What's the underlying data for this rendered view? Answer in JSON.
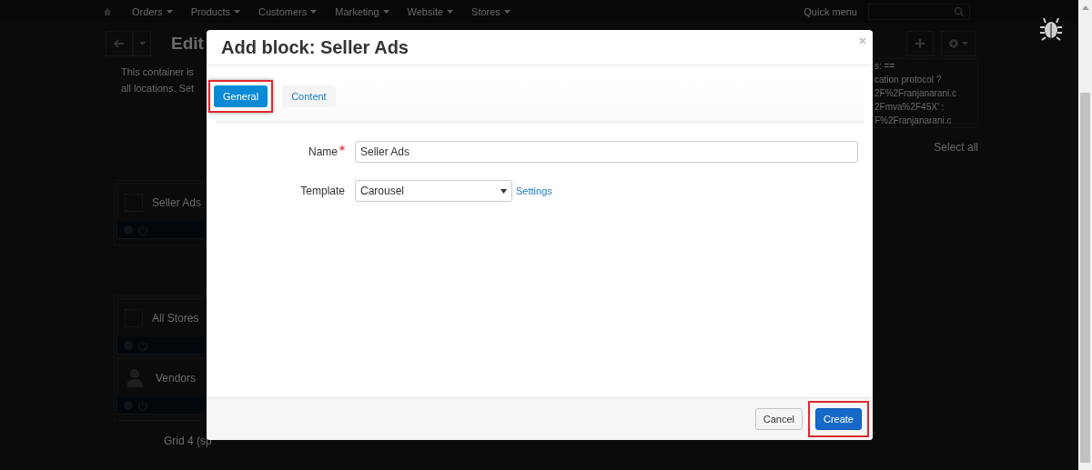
{
  "nav": {
    "items": [
      "Orders",
      "Products",
      "Customers",
      "Marketing",
      "Website",
      "Stores"
    ],
    "quick_menu": "Quick menu"
  },
  "page": {
    "title": "Edit",
    "notice": [
      "This container is",
      "all locations. Set"
    ],
    "code_fragments": [
      "s: ==",
      "cation protocol ?",
      "2F%2Franjanarani.c",
      "2Fmva%2F45X' :",
      "F%2Franjanarani.c"
    ],
    "select_all": "Select all",
    "groups": [
      {
        "blocks": [
          {
            "kind": "placeholder",
            "name": "Seller Ads"
          }
        ]
      },
      {
        "blocks": [
          {
            "kind": "placeholder",
            "name": "All Stores"
          },
          {
            "kind": "person",
            "name": "Vendors"
          }
        ]
      }
    ],
    "grid_label": "Grid 4 (sp"
  },
  "dialog": {
    "title": "Add block: Seller Ads",
    "tabs": [
      {
        "label": "General",
        "selected": true,
        "highlighted": true
      },
      {
        "label": "Content",
        "selected": false,
        "highlighted": false
      }
    ],
    "fields": [
      {
        "kind": "text",
        "label": "Name",
        "required": true,
        "value": "Seller Ads"
      },
      {
        "kind": "select",
        "label": "Template",
        "required": false,
        "value": "Carousel",
        "link": "Settings"
      }
    ],
    "buttons": [
      {
        "kind": "secondary",
        "label": "Cancel",
        "highlighted": false
      },
      {
        "kind": "primary",
        "label": "Create",
        "highlighted": true
      }
    ]
  }
}
